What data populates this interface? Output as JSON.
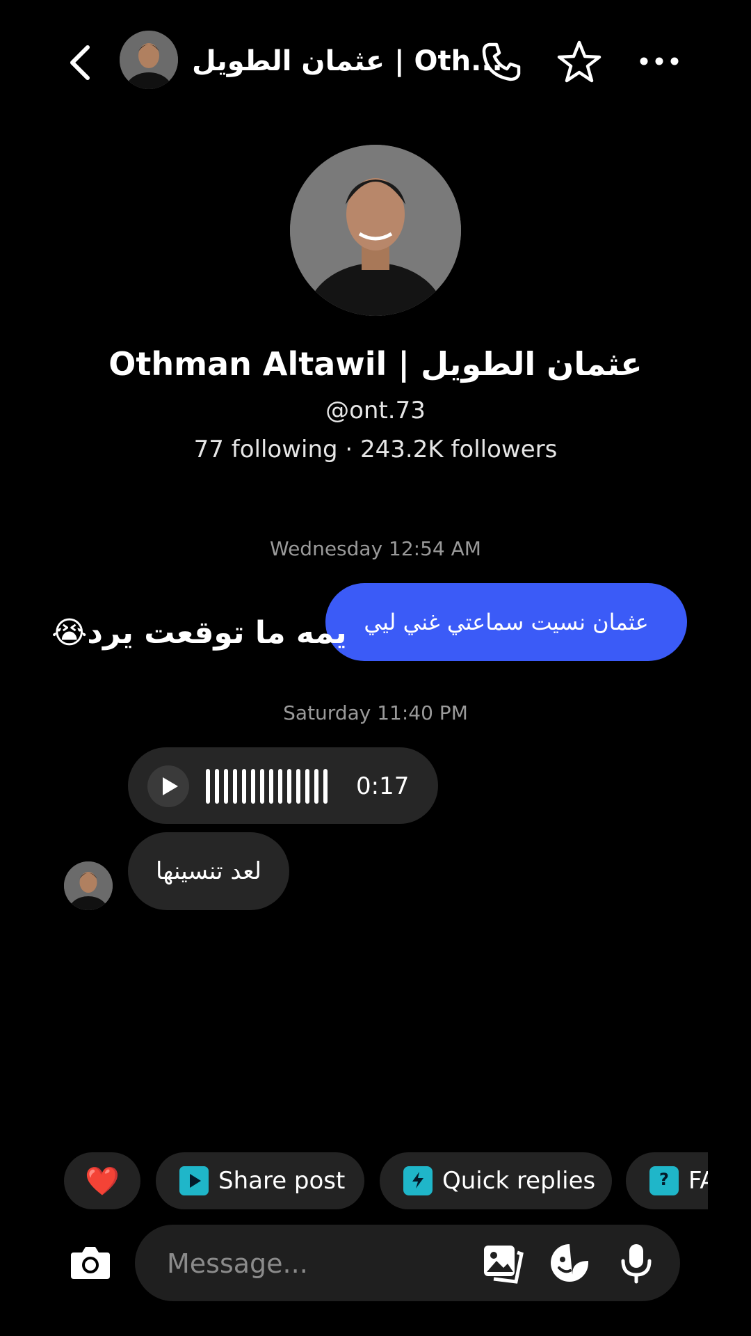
{
  "header": {
    "title": "عثمان الطويل | Oth...",
    "back_icon": "chevron-left-icon",
    "call_icon": "phone-icon",
    "star_icon": "star-icon",
    "more_icon": "more-horizontal-icon"
  },
  "profile": {
    "name": "Othman Altawil | عثمان الطويل",
    "handle": "@ont.73",
    "stats": "77 following · 243.2K followers"
  },
  "thread": {
    "timestamp_1": "Wednesday 12:54 AM",
    "outgoing_message": "عثمان نسيت سماعتي غني ليي",
    "overlay_caption": "يمه ما توقعت يرد😭",
    "timestamp_2": "Saturday 11:40 PM",
    "voice_duration": "0:17",
    "incoming_message": "لعد تنسينها"
  },
  "quick_actions": {
    "heart": "❤️",
    "share_post": "Share post",
    "quick_replies": "Quick replies",
    "faq": "FAQ"
  },
  "composer": {
    "placeholder": "Message..."
  },
  "colors": {
    "outgoing_bubble": "#3b5bf7",
    "incoming_bubble": "#262626",
    "chip_icon": "#1fb6c9",
    "background": "#000000"
  }
}
